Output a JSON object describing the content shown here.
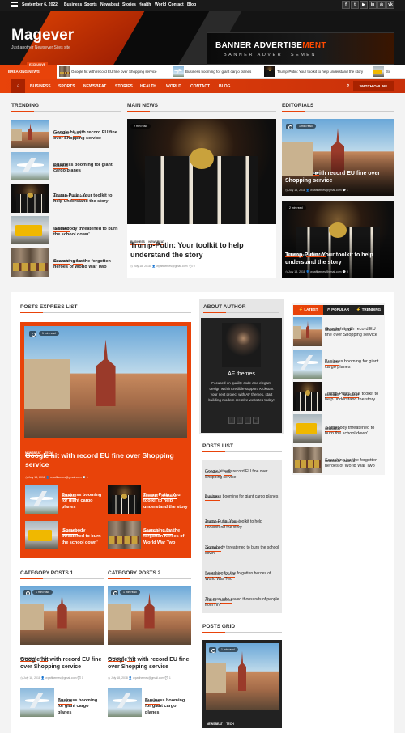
{
  "topbar": {
    "date": "September 6, 2022",
    "links": [
      "Business",
      "Sports",
      "Newsbeat",
      "Stories",
      "Health",
      "World",
      "Contact",
      "Blog"
    ],
    "social_icons": [
      "facebook-icon",
      "twitter-icon",
      "youtube-icon",
      "linkedin-icon",
      "instagram-icon",
      "vk-icon"
    ],
    "social_glyphs": [
      "f",
      "t",
      "▶",
      "in",
      "◎",
      "vk"
    ]
  },
  "header": {
    "logo": "Magever",
    "tagline": "Just another Newsever Sites site",
    "banner_title_a": "BANNER ADVERTISE",
    "banner_title_b": "MENT",
    "banner_sub": "BANNER ADVERTISEMENT"
  },
  "breaking": {
    "exclusive": "EXCLUSIVE",
    "label": "BREAKING NEWS",
    "items": [
      "Google hit with record EU fine over Shopping service",
      "Business booming for giant cargo planes",
      "Trump-Putin: Your toolkit to help understand the story",
      "'Sc"
    ]
  },
  "nav": {
    "home_glyph": "⌂",
    "items": [
      "BUSINESS",
      "SPORTS",
      "NEWSBEAT",
      "STORIES",
      "HEALTH",
      "WORLD",
      "CONTACT",
      "BLOG"
    ],
    "search_glyph": "⌕",
    "watch": "WATCH ONLINE"
  },
  "trending": {
    "title": "TRENDING",
    "items": [
      {
        "tags": [
          "NEWSBEAT",
          "TECH"
        ],
        "title": "Google hit with record EU fine over Shopping service"
      },
      {
        "tags": [
          "BUSINESS"
        ],
        "title": "Business booming for giant cargo planes"
      },
      {
        "tags": [
          "BUSINESS",
          "NEWSBEAT"
        ],
        "title": "Trump-Putin: Your toolkit to help understand the story"
      },
      {
        "tags": [
          "NEWSBEAT"
        ],
        "title": "'Somebody threatened to burn the school down'"
      },
      {
        "tags": [
          "NEWSBEAT",
          "WORLD"
        ],
        "title": "Searching for the forgotten heroes of World War Two"
      }
    ]
  },
  "main_news": {
    "title": "MAIN NEWS",
    "read": "2 min read",
    "tags": [
      "BUSINESS",
      "NEWSBEAT"
    ],
    "headline": "Trump-Putin: Your toolkit to help understand the story",
    "date": "July 18, 2018",
    "author": "wpafthemes@gmail.com",
    "comments": "0"
  },
  "editorials": {
    "title": "EDITORIALS",
    "items": [
      {
        "read": "1 min read",
        "tags": [
          "NEWSBEAT",
          "TECH"
        ],
        "title": "Google hit with record EU fine over Shopping service",
        "date": "July 18, 2018",
        "author": "wpafthemes@gmail.com",
        "comments": "1"
      },
      {
        "read": "2 min read",
        "tags": [
          "BUSINESS",
          "NEWSBEAT"
        ],
        "title": "Trump-Putin: Your toolkit to help understand the story",
        "date": "July 18, 2018",
        "author": "wpafthemes@gmail.com",
        "comments": "0"
      }
    ]
  },
  "express": {
    "title": "POSTS EXPRESS LIST",
    "read": "1 min read",
    "tags": [
      "NEWSBEAT",
      "TECH"
    ],
    "headline": "Google hit with record EU fine over Shopping service",
    "date": "July 18, 2018",
    "author": "wpafthemes@gmail.com",
    "comments": "1",
    "items": [
      {
        "tags": [
          "BUSINESS"
        ],
        "title": "Business booming for giant cargo planes"
      },
      {
        "tags": [
          "BUSINESS",
          "NEWSBEAT"
        ],
        "title": "Trump-Putin: Your toolkit to help understand the story"
      },
      {
        "tags": [
          "NEWSBEAT"
        ],
        "title": "'Somebody threatened to burn the school down'"
      },
      {
        "tags": [
          "NEWSBEAT",
          "WORLD"
        ],
        "title": "Searching for the forgotten heroes of World War Two"
      }
    ]
  },
  "about": {
    "title": "ABOUT AUTHOR",
    "name": "AF themes",
    "bio": "Focused on quality code and elegant design with incredible support. Kickstart your next project with AF themes, start building modern creative websites today!",
    "social_glyphs": [
      "f",
      "t",
      "◎",
      "▶"
    ]
  },
  "posts_list": {
    "title": "POSTS LIST",
    "items": [
      {
        "tags": [
          "NEWSBEAT",
          "TECH"
        ],
        "title": "Google hit with record EU fine over Shopping service"
      },
      {
        "tags": [
          "BUSINESS"
        ],
        "title": "Business booming for giant cargo planes"
      },
      {
        "tags": [
          "BUSINESS",
          "NEWSBEAT"
        ],
        "title": "Trump-Putin: Your toolkit to help understand the story"
      },
      {
        "tags": [
          "NEWSBEAT"
        ],
        "title": "'Somebody threatened to burn the school down'"
      },
      {
        "tags": [
          "NEWSBEAT",
          "WORLD"
        ],
        "title": "Searching for the forgotten heroes of World War Two"
      },
      {
        "tags": [
          "HEALTH",
          "SCIENCE"
        ],
        "title": "The man who saved thousands of people from HIV"
      }
    ]
  },
  "posts_grid": {
    "title": "POSTS GRID",
    "read": "1 min read",
    "tags": [
      "NEWSBEAT",
      "TECH"
    ]
  },
  "tabs": {
    "items": [
      {
        "glyph": "⚡",
        "label": "LATEST"
      },
      {
        "glyph": "◷",
        "label": "POPULAR"
      },
      {
        "glyph": "⚡",
        "label": "TRENDING"
      }
    ],
    "list": [
      {
        "tags": [
          "NEWSBEAT",
          "TECH"
        ],
        "title": "Google hit with record EU fine over Shopping service"
      },
      {
        "tags": [
          "BUSINESS"
        ],
        "title": "Business booming for giant cargo planes"
      },
      {
        "tags": [
          "BUSINESS",
          "NEWSBEAT"
        ],
        "title": "Trump-Putin: Your toolkit to help understand the story"
      },
      {
        "tags": [
          "NEWSBEAT"
        ],
        "title": "'Somebody threatened to burn the school down'"
      },
      {
        "tags": [
          "NEWSBEAT",
          "WORLD"
        ],
        "title": "Searching for the forgotten heroes of World War Two"
      }
    ]
  },
  "category1": {
    "title": "CATEGORY POSTS 1",
    "read": "1 min read",
    "tags": [
      "NEWSBEAT",
      "TECH"
    ],
    "headline": "Google hit with record EU fine over Shopping service",
    "date": "July 18, 2018",
    "author": "wpafthemes@gmail.com",
    "comments": "1",
    "sub_tags": [
      "BUSINESS"
    ],
    "sub_title": "Business booming for giant cargo planes"
  },
  "category2": {
    "title": "CATEGORY POSTS 2",
    "read": "1 min read",
    "tags": [
      "NEWSBEAT",
      "TECH"
    ],
    "headline": "Google hit with record EU fine over Shopping service",
    "date": "July 18, 2018",
    "author": "wpafthemes@gmail.com",
    "comments": "1",
    "sub_tags": [
      "BUSINESS"
    ],
    "sub_title": "Business booming for giant cargo planes"
  },
  "colors": {
    "accent": "#e8430a",
    "dark": "#1a1a1a"
  }
}
